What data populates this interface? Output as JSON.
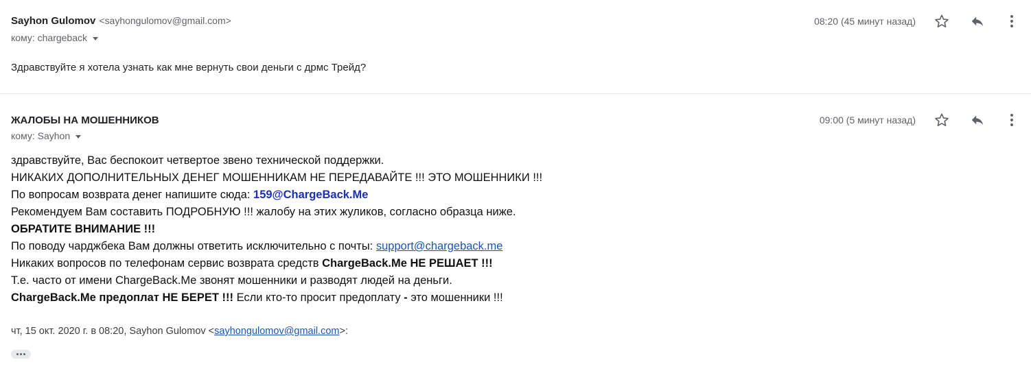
{
  "messages": [
    {
      "sender_name": "Sayhon Gulomov",
      "sender_email": "<sayhongulomov@gmail.com>",
      "to": "кому: chargeback",
      "time": "08:20 (45 минут назад)",
      "body": "Здравствуйте я хотела узнать как мне вернуть свои деньги с дрмс Трейд?"
    },
    {
      "sender_name": "ЖАЛОБЫ НА МОШЕННИКОВ",
      "to": "кому: Sayhon",
      "time": "09:00 (5 минут назад)",
      "lines": {
        "l1": "здравствуйте, Вас беспокоит четвертое звено технической поддержки.",
        "l2": "НИКАКИХ ДОПОЛНИТЕЛЬНЫХ ДЕНЕГ МОШЕННИКАМ НЕ ПЕРЕДАВАЙТЕ !!! ЭТО МОШЕННИКИ !!!",
        "l3_a": "По вопросам возврата денег напишите сюда: ",
        "l3_b": "159@ChargeBack.Me",
        "l4": "Рекомендуем Вам составить ПОДРОБНУЮ !!! жалобу на этих жуликов, согласно образца ниже.",
        "l5": "ОБРАТИТЕ ВНИМАНИЕ !!!",
        "l6_a": "По поводу чарджбека Вам должны ответить исключительно с почты: ",
        "l6_b": "support@chargeback.me",
        "l7_a": "Никаких вопросов по телефонам сервис возврата средств ",
        "l7_b": "ChargeBack.Me НЕ РЕШАЕТ !!!",
        "l8": "Т.е. часто от имени ChargeBack.Me звонят мошенники и разводят людей на деньги.",
        "l9_a": "ChargeBack.Me предоплат НЕ БЕРЕТ !!!",
        "l9_b": " Если кто-то просит предоплату ",
        "l9_c": "-",
        "l9_d": " это мошенники !!!"
      },
      "quote_prefix": "чт, 15 окт. 2020 г. в 08:20, Sayhon Gulomov <",
      "quote_email": "sayhongulomov@gmail.com",
      "quote_suffix": ">:"
    }
  ],
  "icons": {
    "star": "star-icon",
    "reply": "reply-icon",
    "more": "more-vert-icon",
    "expand": "more-horiz-icon"
  },
  "colors": {
    "link": "#1a55b5",
    "highlight_email": "#1a2fb5"
  }
}
